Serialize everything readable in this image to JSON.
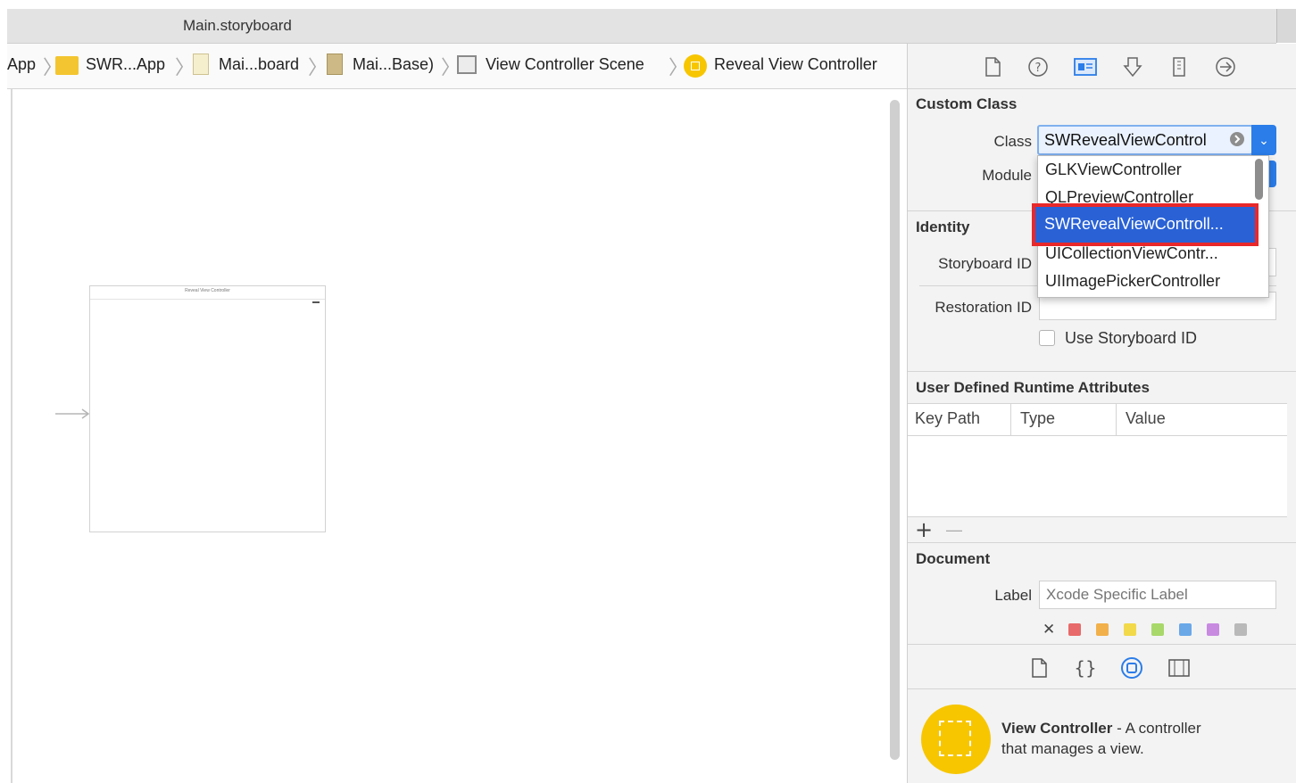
{
  "window": {
    "title": "Main.storyboard"
  },
  "jumpbar": {
    "crumbs": [
      "App",
      "SWR...App",
      "Mai...board",
      "Mai...Base)",
      "View Controller Scene",
      "Reveal View Controller"
    ]
  },
  "canvas": {
    "vc_title": "Reveal View Controller"
  },
  "inspector": {
    "tabs": [
      "file-inspector",
      "quick-help",
      "identity-inspector",
      "attributes-inspector",
      "size-inspector",
      "connections-inspector"
    ],
    "custom_class": {
      "header": "Custom Class",
      "class_label": "Class",
      "class_value": "SWRevealViewControl",
      "module_label": "Module"
    },
    "dropdown": {
      "items": [
        "GLKViewController",
        "QLPreviewController",
        "SWRevealViewControll...",
        "UICollectionViewContr...",
        "UIImagePickerController"
      ],
      "selected_index": 2
    },
    "identity": {
      "header": "Identity",
      "storyboard_id_label": "Storyboard ID",
      "restoration_id_label": "Restoration ID",
      "use_storyboard_id_label": "Use Storyboard ID",
      "use_storyboard_id_checked": false
    },
    "runtime_attributes": {
      "header": "User Defined Runtime Attributes",
      "columns": [
        "Key Path",
        "Type",
        "Value"
      ],
      "add": "+",
      "remove": "—"
    },
    "document": {
      "header": "Document",
      "label_label": "Label",
      "label_placeholder": "Xcode Specific Label",
      "clear": "✕",
      "colors": [
        "#e86a6a",
        "#f2b04a",
        "#f2d94a",
        "#a8d86a",
        "#6aa8e8",
        "#c88ae0",
        "#b9b9b9"
      ]
    },
    "library_tabs": [
      "file-template",
      "code-snippet",
      "object-library",
      "media-library"
    ],
    "library_item": {
      "name": "View Controller",
      "sep": " - ",
      "desc_line1": "A controller",
      "desc_line2": "that manages a view."
    }
  }
}
